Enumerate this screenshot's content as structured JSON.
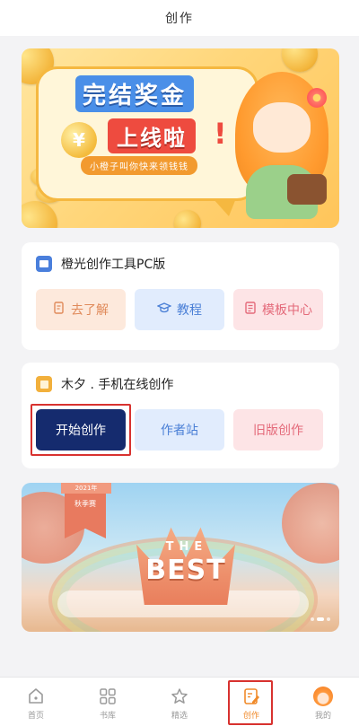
{
  "header": {
    "title": "创作"
  },
  "banner_top": {
    "title_line1": "完结奖金",
    "title_line2": "上线啦",
    "exclaim": "!",
    "subtitle": "小橙子叫你快来领钱钱",
    "coin_symbol": "¥"
  },
  "card_pc": {
    "title": "橙光创作工具PC版",
    "buttons": [
      {
        "label": "去了解",
        "icon": "info-doc-icon"
      },
      {
        "label": "教程",
        "icon": "graduation-cap-icon"
      },
      {
        "label": "模板中心",
        "icon": "template-icon"
      }
    ]
  },
  "card_mobile": {
    "title": "木夕 . 手机在线创作",
    "buttons": [
      {
        "label": "开始创作"
      },
      {
        "label": "作者站"
      },
      {
        "label": "旧版创作"
      }
    ]
  },
  "banner_bottom": {
    "ribbon_year": "2021年",
    "ribbon_text": "秋季赛",
    "word_the": "THE",
    "word_best": "BEST"
  },
  "bottom_nav": {
    "items": [
      {
        "label": "首页",
        "icon": "home-icon"
      },
      {
        "label": "书库",
        "icon": "grid-icon"
      },
      {
        "label": "精选",
        "icon": "star-icon"
      },
      {
        "label": "创作",
        "icon": "edit-doc-icon",
        "active": true
      },
      {
        "label": "我的",
        "icon": "avatar"
      }
    ]
  },
  "colors": {
    "accent_orange": "#f08a2a",
    "primary_dark_blue": "#152b6e",
    "highlight_red": "#d8322f"
  }
}
